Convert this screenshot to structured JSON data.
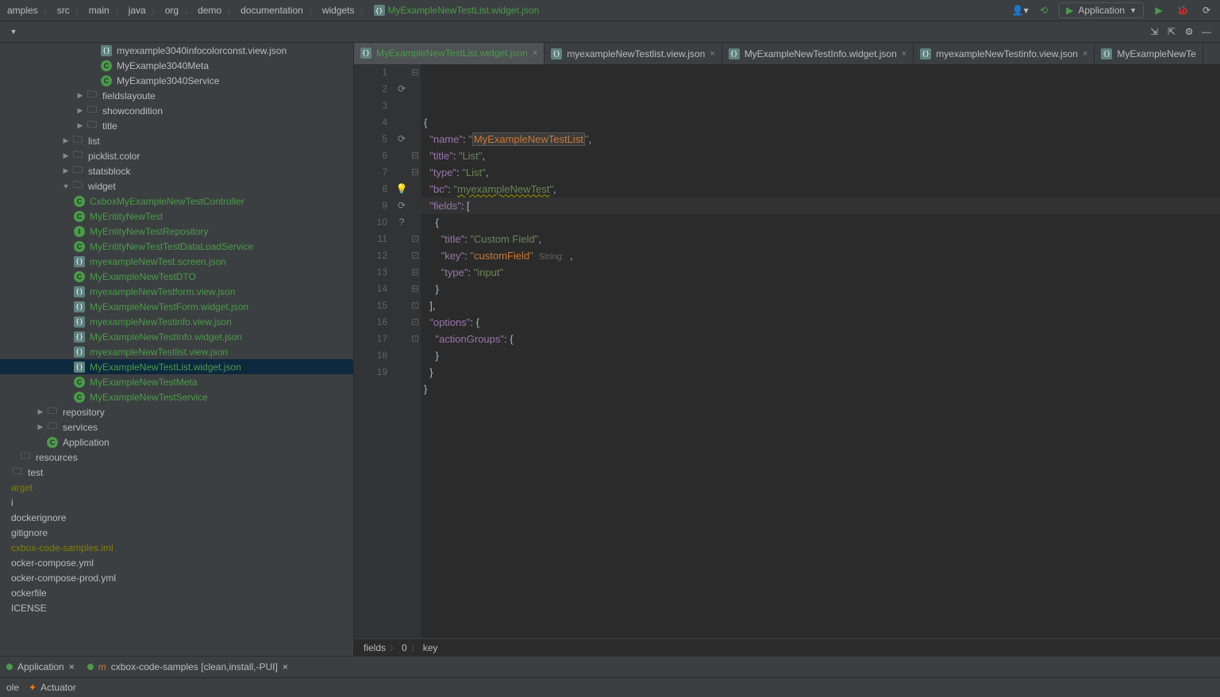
{
  "breadcrumbs": [
    "amples",
    "src",
    "main",
    "java",
    "org",
    "demo",
    "documentation",
    "widgets"
  ],
  "breadcrumb_active": "MyExampleNewTestList.widget.json",
  "run_config_label": "Application",
  "tree": {
    "items": [
      {
        "label": "myexample3040infocolorconst.view.json",
        "indent": 112,
        "icon": "json",
        "cls": ""
      },
      {
        "label": "MyExample3040Meta",
        "indent": 112,
        "icon": "class",
        "cls": ""
      },
      {
        "label": "MyExample3040Service",
        "indent": 112,
        "icon": "class",
        "cls": ""
      },
      {
        "label": "fieldslayoute",
        "indent": 94,
        "icon": "folder",
        "expand": "▶",
        "cls": ""
      },
      {
        "label": "showcondition",
        "indent": 94,
        "icon": "folder",
        "expand": "▶",
        "cls": ""
      },
      {
        "label": "title",
        "indent": 94,
        "icon": "folder",
        "expand": "▶",
        "cls": ""
      },
      {
        "label": "list",
        "indent": 76,
        "icon": "folder",
        "expand": "▶",
        "cls": ""
      },
      {
        "label": "picklist.color",
        "indent": 76,
        "icon": "folder",
        "expand": "▶",
        "cls": ""
      },
      {
        "label": "statsblock",
        "indent": 76,
        "icon": "folder",
        "expand": "▶",
        "cls": ""
      },
      {
        "label": "widget",
        "indent": 76,
        "icon": "folder",
        "expand": "▼",
        "cls": ""
      },
      {
        "label": "CxboxMyExampleNewTestController",
        "indent": 78,
        "icon": "class",
        "cls": "green"
      },
      {
        "label": "MyEntityNewTest",
        "indent": 78,
        "icon": "class",
        "cls": "green"
      },
      {
        "label": "MyEntityNewTestRepository",
        "indent": 78,
        "icon": "interface",
        "cls": "green"
      },
      {
        "label": "MyEntityNewTestTestDataLoadService",
        "indent": 78,
        "icon": "class",
        "cls": "green"
      },
      {
        "label": "myexampleNewTest.screen.json",
        "indent": 78,
        "icon": "json",
        "cls": "green"
      },
      {
        "label": "MyExampleNewTestDTO",
        "indent": 78,
        "icon": "class",
        "cls": "green"
      },
      {
        "label": "myexampleNewTestform.view.json",
        "indent": 78,
        "icon": "json",
        "cls": "green"
      },
      {
        "label": "MyExampleNewTestForm.widget.json",
        "indent": 78,
        "icon": "json",
        "cls": "green"
      },
      {
        "label": "myexampleNewTestinfo.view.json",
        "indent": 78,
        "icon": "json",
        "cls": "green"
      },
      {
        "label": "MyExampleNewTestInfo.widget.json",
        "indent": 78,
        "icon": "json",
        "cls": "green"
      },
      {
        "label": "myexampleNewTestlist.view.json",
        "indent": 78,
        "icon": "json",
        "cls": "green"
      },
      {
        "label": "MyExampleNewTestList.widget.json",
        "indent": 78,
        "icon": "json",
        "cls": "green",
        "selected": true
      },
      {
        "label": "MyExampleNewTestMeta",
        "indent": 78,
        "icon": "class",
        "cls": "green"
      },
      {
        "label": "MyExampleNewTestService",
        "indent": 78,
        "icon": "class",
        "cls": "green"
      },
      {
        "label": "repository",
        "indent": 44,
        "icon": "folder",
        "expand": "▶",
        "cls": ""
      },
      {
        "label": "services",
        "indent": 44,
        "icon": "folder",
        "expand": "▶",
        "cls": ""
      },
      {
        "label": "Application",
        "indent": 44,
        "icon": "app",
        "cls": ""
      },
      {
        "label": "resources",
        "indent": 10,
        "icon": "folder",
        "cls": ""
      },
      {
        "label": "test",
        "indent": 0,
        "icon": "folder",
        "cls": ""
      },
      {
        "label": "arget",
        "indent": 0,
        "icon": "",
        "cls": "olive"
      },
      {
        "label": "i",
        "indent": 0,
        "icon": "",
        "cls": ""
      },
      {
        "label": "dockerignore",
        "indent": 0,
        "icon": "",
        "cls": ""
      },
      {
        "label": "gitignore",
        "indent": 0,
        "icon": "",
        "cls": ""
      },
      {
        "label": "cxbox-code-samples.iml",
        "indent": 0,
        "icon": "",
        "cls": "olive"
      },
      {
        "label": "ocker-compose.yml",
        "indent": 0,
        "icon": "",
        "cls": ""
      },
      {
        "label": "ocker-compose-prod.yml",
        "indent": 0,
        "icon": "",
        "cls": ""
      },
      {
        "label": "ockerfile",
        "indent": 0,
        "icon": "",
        "cls": ""
      },
      {
        "label": "ICENSE",
        "indent": 0,
        "icon": "",
        "cls": ""
      }
    ]
  },
  "tabs": [
    {
      "label": "MyExampleNewTestList.widget.json",
      "active": true
    },
    {
      "label": "myexampleNewTestlist.view.json"
    },
    {
      "label": "MyExampleNewTestInfo.widget.json"
    },
    {
      "label": "myexampleNewTestinfo.view.json"
    },
    {
      "label": "MyExampleNewTe"
    }
  ],
  "gutter_lines": [
    "1",
    "2",
    "3",
    "4",
    "5",
    "6",
    "7",
    "8",
    "9",
    "10",
    "11",
    "12",
    "13",
    "14",
    "15",
    "16",
    "17",
    "18",
    "19"
  ],
  "fold_marks": [
    "⊟",
    "",
    "",
    "",
    "",
    "⊟",
    "⊟",
    "",
    "",
    "",
    "⊡",
    "⊡",
    "⊟",
    "⊟",
    "⊡",
    "⊡",
    "⊡",
    "",
    ""
  ],
  "gutter_icons": {
    "2": "cycle",
    "5": "cycle",
    "8": "bulb",
    "9": "cycle",
    "10": "q"
  },
  "code_lines": [
    "{",
    "  \"name\": \"MyExampleNewTestList\",",
    "  \"title\": \"List\",",
    "  \"type\": \"List\",",
    "  \"bc\": \"myexampleNewTest\",",
    "  \"fields\": [",
    "    {",
    "      \"title\": \"Custom Field\",",
    "      \"key\": \"customField\"  String:  ,",
    "      \"type\": \"input\"",
    "    }",
    "  ],",
    "  \"options\": {",
    "    \"actionGroups\": {",
    "    }",
    "  }",
    "}",
    "",
    ""
  ],
  "breadcrumb_bottom": [
    "fields",
    "0",
    "key"
  ],
  "bottom_tabs": [
    {
      "label": "Application"
    },
    {
      "label": "cxbox-code-samples [clean,install,-PUI]"
    }
  ],
  "bottom_bar": {
    "console": "ole",
    "actuator": "Actuator"
  }
}
